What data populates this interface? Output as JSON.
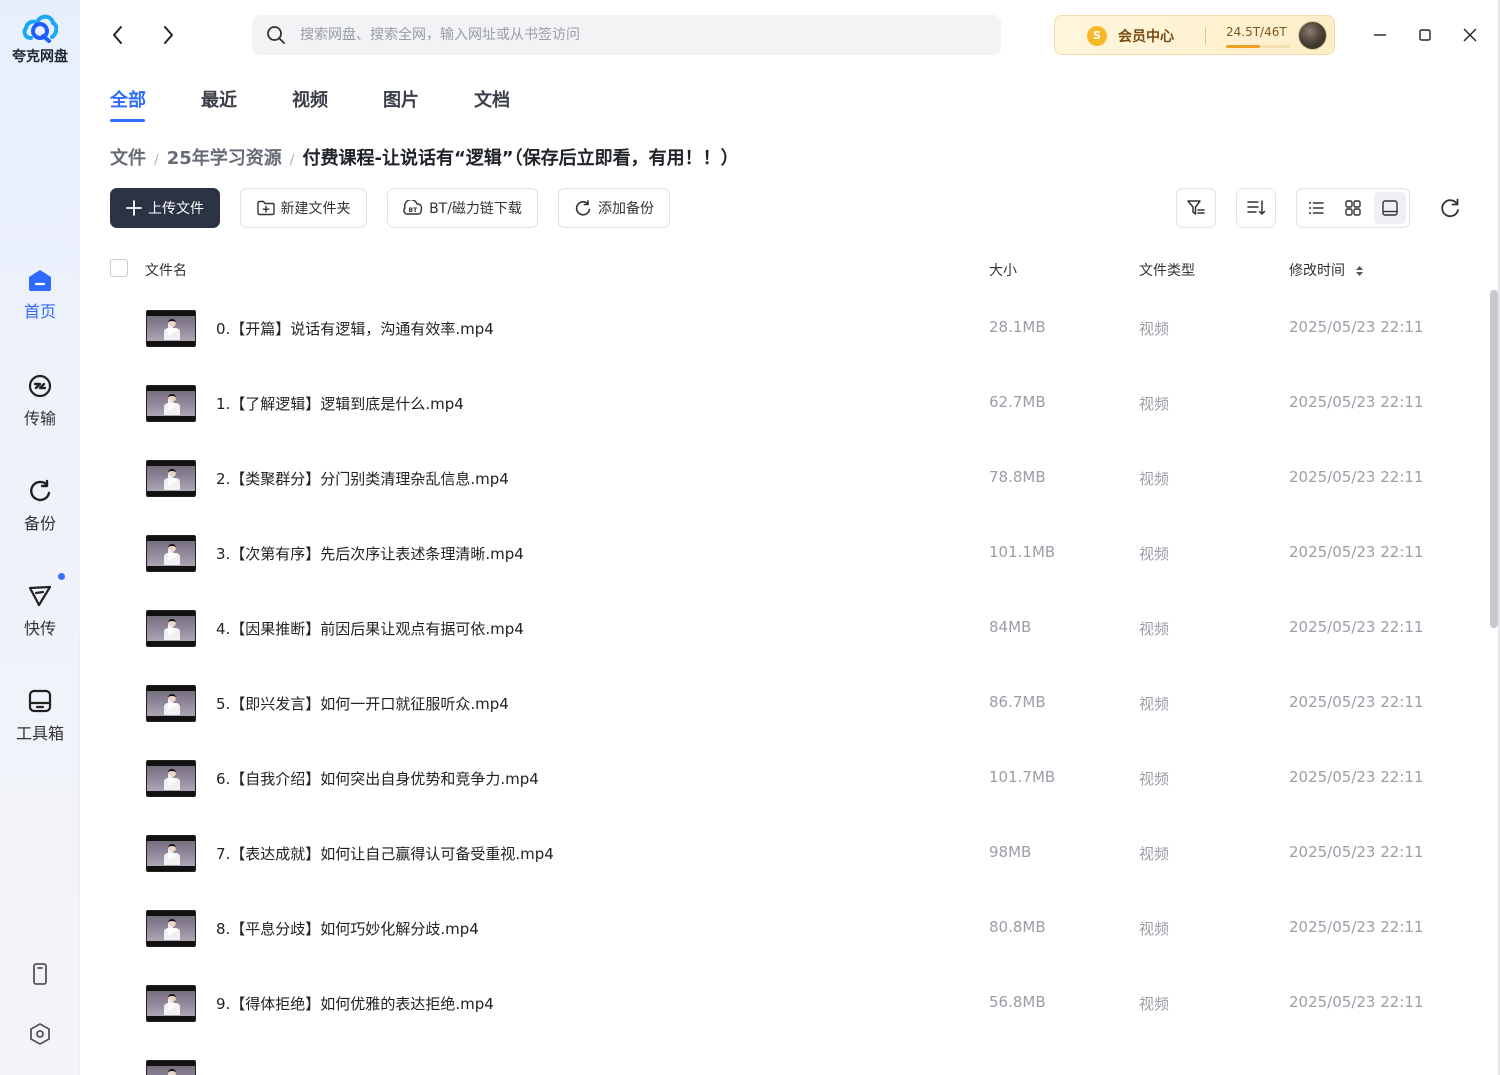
{
  "app": {
    "name": "夸克网盘"
  },
  "sidebar": {
    "items": [
      {
        "label": "首页",
        "icon": "home-icon",
        "active": true
      },
      {
        "label": "传输",
        "icon": "transfer-icon"
      },
      {
        "label": "备份",
        "icon": "backup-icon"
      },
      {
        "label": "快传",
        "icon": "quick-send-icon",
        "badge_dot": true
      },
      {
        "label": "工具箱",
        "icon": "toolbox-icon"
      }
    ],
    "bottom": [
      "phone-icon",
      "settings-icon"
    ]
  },
  "search": {
    "placeholder": "搜索网盘、搜索全网，输入网址或从书签访问"
  },
  "vip": {
    "label": "会员中心",
    "storage": "24.5T/46T",
    "usage_fraction": 0.53,
    "coin_symbol": "S"
  },
  "tabs": [
    "全部",
    "最近",
    "视频",
    "图片",
    "文档"
  ],
  "breadcrumb": {
    "items": [
      "文件",
      "25年学习资源"
    ],
    "separator": "/",
    "current": "付费课程-让说话有“逻辑”（保存后立即看，有用！！）"
  },
  "toolbar": {
    "upload": "上传文件",
    "new_folder": "新建文件夹",
    "bt_download": "BT/磁力链下载",
    "add_backup": "添加备份"
  },
  "table": {
    "headers": {
      "name": "文件名",
      "size": "大小",
      "type": "文件类型",
      "modified": "修改时间"
    },
    "rows": [
      {
        "name": "0.【开篇】说话有逻辑，沟通有效率.mp4",
        "size": "28.1MB",
        "type": "视频",
        "modified": "2025/05/23 22:11"
      },
      {
        "name": "1.【了解逻辑】逻辑到底是什么.mp4",
        "size": "62.7MB",
        "type": "视频",
        "modified": "2025/05/23 22:11"
      },
      {
        "name": "2.【类聚群分】分门别类清理杂乱信息.mp4",
        "size": "78.8MB",
        "type": "视频",
        "modified": "2025/05/23 22:11"
      },
      {
        "name": "3.【次第有序】先后次序让表述条理清晰.mp4",
        "size": "101.1MB",
        "type": "视频",
        "modified": "2025/05/23 22:11"
      },
      {
        "name": "4.【因果推断】前因后果让观点有据可依.mp4",
        "size": "84MB",
        "type": "视频",
        "modified": "2025/05/23 22:11"
      },
      {
        "name": "5.【即兴发言】如何一开口就征服听众.mp4",
        "size": "86.7MB",
        "type": "视频",
        "modified": "2025/05/23 22:11"
      },
      {
        "name": "6.【自我介绍】如何突出自身优势和竞争力.mp4",
        "size": "101.7MB",
        "type": "视频",
        "modified": "2025/05/23 22:11"
      },
      {
        "name": "7.【表达成就】如何让自己赢得认可备受重视.mp4",
        "size": "98MB",
        "type": "视频",
        "modified": "2025/05/23 22:11"
      },
      {
        "name": "8.【平息分歧】如何巧妙化解分歧.mp4",
        "size": "80.8MB",
        "type": "视频",
        "modified": "2025/05/23 22:11"
      },
      {
        "name": "9.【得体拒绝】如何优雅的表达拒绝.mp4",
        "size": "56.8MB",
        "type": "视频",
        "modified": "2025/05/23 22:11"
      },
      {
        "name": "",
        "size": "",
        "type": "",
        "modified": ""
      }
    ]
  },
  "colors": {
    "accent": "#2f6bff",
    "primary_button": "#2c3345",
    "vip_bg": "#fdeec8"
  }
}
